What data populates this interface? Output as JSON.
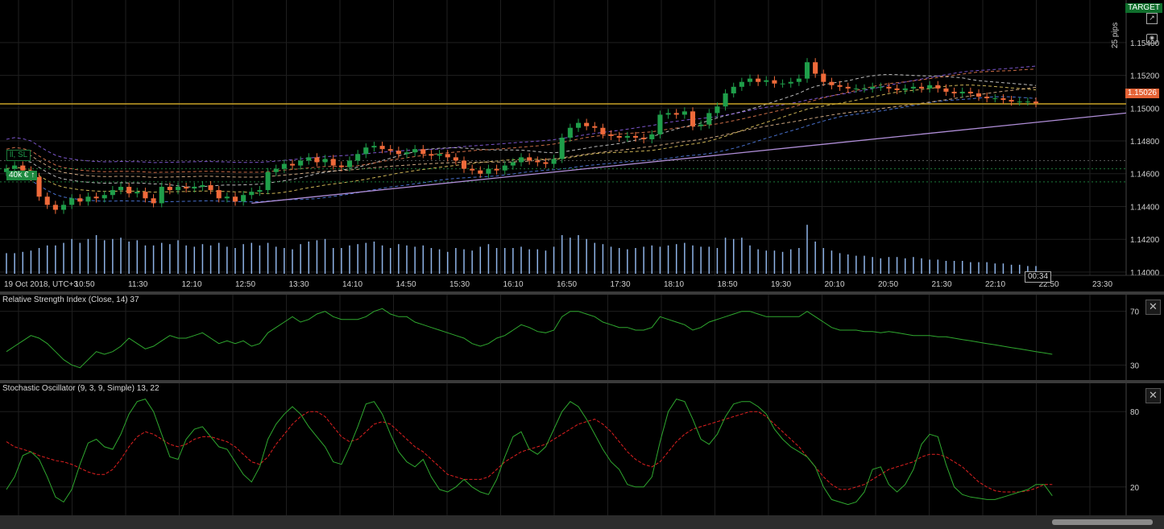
{
  "chart_data": [
    {
      "type": "candlestick",
      "x_ticks": [
        "19 Oct 2018, UTC+3",
        "10:50",
        "11:30",
        "12:10",
        "12:50",
        "13:30",
        "14:10",
        "14:50",
        "15:30",
        "16:10",
        "16:50",
        "17:30",
        "18:10",
        "18:50",
        "19:30",
        "20:10",
        "20:50",
        "21:30",
        "22:10",
        "22:50",
        "23:30"
      ],
      "y_ticks": [
        "1.15400",
        "1.15200",
        "1.15000",
        "1.14800",
        "1.14600",
        "1.14400",
        "1.14200",
        "1.14000"
      ],
      "ylim": [
        1.1398,
        1.1563
      ],
      "current_price": "1.15026",
      "countdown": "00:34",
      "target_label": "TARGET",
      "pips_label": "25 pips",
      "sl_label": "ll, SL",
      "position_label": "40k € ↑",
      "closes": [
        1.1463,
        1.1465,
        1.1462,
        1.1458,
        1.1446,
        1.1441,
        1.1438,
        1.1441,
        1.1445,
        1.1443,
        1.1446,
        1.1445,
        1.1447,
        1.145,
        1.1452,
        1.1448,
        1.1449,
        1.1445,
        1.1442,
        1.1452,
        1.145,
        1.1452,
        1.1451,
        1.1452,
        1.1453,
        1.145,
        1.1445,
        1.1446,
        1.1443,
        1.1447,
        1.1449,
        1.145,
        1.1461,
        1.1463,
        1.1466,
        1.1465,
        1.1468,
        1.147,
        1.1467,
        1.1469,
        1.1465,
        1.1464,
        1.1468,
        1.1472,
        1.1476,
        1.1477,
        1.1475,
        1.1474,
        1.1472,
        1.1473,
        1.1475,
        1.1472,
        1.1471,
        1.1472,
        1.147,
        1.1468,
        1.1463,
        1.1462,
        1.146,
        1.1463,
        1.1462,
        1.1465,
        1.1467,
        1.147,
        1.1468,
        1.1467,
        1.1466,
        1.1469,
        1.1482,
        1.1488,
        1.1491,
        1.1489,
        1.1488,
        1.1484,
        1.1483,
        1.1482,
        1.1483,
        1.1482,
        1.1481,
        1.1484,
        1.1496,
        1.1497,
        1.1496,
        1.1498,
        1.1489,
        1.149,
        1.1497,
        1.1501,
        1.1509,
        1.1513,
        1.1516,
        1.1518,
        1.1516,
        1.1517,
        1.1515,
        1.1515,
        1.1516,
        1.1518,
        1.1528,
        1.1521,
        1.1516,
        1.1514,
        1.1513,
        1.1512,
        1.1512,
        1.1512,
        1.1513,
        1.1513,
        1.1512,
        1.1511,
        1.1512,
        1.1513,
        1.1512,
        1.1514,
        1.1512,
        1.151,
        1.1509,
        1.151,
        1.1509,
        1.1507,
        1.1506,
        1.1506,
        1.1505,
        1.1504,
        1.1504,
        1.1504,
        1.1503
      ],
      "volumes": [
        16,
        16,
        17,
        18,
        20,
        22,
        22,
        24,
        27,
        24,
        27,
        30,
        26,
        27,
        28,
        25,
        26,
        22,
        22,
        24,
        23,
        26,
        22,
        21,
        23,
        22,
        24,
        21,
        20,
        23,
        24,
        22,
        24,
        21,
        20,
        19,
        23,
        25,
        26,
        27,
        20,
        20,
        22,
        23,
        24,
        25,
        22,
        20,
        23,
        22,
        21,
        22,
        20,
        19,
        17,
        20,
        19,
        18,
        21,
        23,
        20,
        20,
        20,
        21,
        19,
        19,
        18,
        21,
        30,
        28,
        30,
        27,
        24,
        23,
        21,
        20,
        19,
        20,
        21,
        22,
        21,
        22,
        23,
        24,
        22,
        21,
        21,
        20,
        28,
        27,
        28,
        22,
        19,
        18,
        18,
        17,
        19,
        20,
        38,
        25,
        20,
        18,
        16,
        15,
        14,
        14,
        13,
        12,
        13,
        13,
        12,
        13,
        12,
        11,
        11,
        10,
        10,
        10,
        9,
        9,
        9,
        8,
        8,
        7,
        7,
        6,
        6
      ],
      "rsi_title": "Relative Strength Index (Close, 14) 37",
      "rsi_ylim": [
        20,
        80
      ],
      "rsi_ticks": [
        "70",
        "30"
      ],
      "rsi": [
        40,
        44,
        48,
        52,
        50,
        46,
        40,
        34,
        30,
        28,
        34,
        40,
        38,
        40,
        44,
        50,
        46,
        42,
        44,
        48,
        52,
        50,
        50,
        52,
        54,
        50,
        46,
        48,
        46,
        48,
        44,
        46,
        54,
        58,
        62,
        66,
        62,
        64,
        68,
        70,
        66,
        64,
        64,
        64,
        66,
        70,
        72,
        68,
        66,
        66,
        62,
        60,
        58,
        56,
        54,
        52,
        50,
        46,
        44,
        46,
        50,
        52,
        56,
        60,
        58,
        55,
        54,
        56,
        66,
        70,
        70,
        68,
        66,
        62,
        60,
        58,
        58,
        56,
        56,
        58,
        66,
        64,
        62,
        60,
        56,
        58,
        62,
        64,
        66,
        68,
        70,
        70,
        68,
        66,
        66,
        66,
        66,
        66,
        70,
        66,
        62,
        58,
        56,
        56,
        56,
        55,
        55,
        54,
        55,
        54,
        53,
        52,
        52,
        52,
        51,
        51,
        50,
        49,
        48,
        47,
        46,
        45,
        44,
        43,
        42,
        41,
        40,
        39,
        38
      ],
      "stoch_title": "Stochastic Oscillator (9, 3, 9, Simple) 13, 22",
      "stoch_ylim": [
        0,
        100
      ],
      "stoch_ticks": [
        "80",
        "20"
      ],
      "stoch_k": [
        18,
        28,
        45,
        48,
        42,
        28,
        12,
        8,
        18,
        38,
        55,
        58,
        52,
        50,
        62,
        78,
        88,
        90,
        80,
        62,
        44,
        42,
        58,
        66,
        68,
        60,
        52,
        50,
        40,
        30,
        24,
        36,
        58,
        70,
        78,
        84,
        78,
        68,
        60,
        52,
        40,
        38,
        52,
        68,
        86,
        88,
        78,
        62,
        48,
        40,
        36,
        42,
        28,
        18,
        16,
        20,
        26,
        20,
        16,
        14,
        26,
        44,
        60,
        64,
        50,
        46,
        52,
        66,
        80,
        88,
        84,
        74,
        62,
        50,
        40,
        34,
        22,
        20,
        20,
        28,
        56,
        80,
        90,
        88,
        74,
        58,
        54,
        62,
        76,
        86,
        88,
        88,
        84,
        78,
        66,
        58,
        52,
        48,
        44,
        36,
        20,
        10,
        8,
        6,
        8,
        16,
        34,
        36,
        22,
        16,
        22,
        34,
        54,
        62,
        60,
        38,
        20,
        14,
        12,
        11,
        10,
        10,
        12,
        14,
        16,
        18,
        22,
        22,
        13
      ],
      "stoch_d": [
        56,
        52,
        50,
        48,
        45,
        43,
        41,
        40,
        38,
        35,
        32,
        30,
        30,
        34,
        42,
        52,
        60,
        64,
        62,
        58,
        54,
        52,
        54,
        58,
        60,
        60,
        58,
        56,
        52,
        46,
        40,
        38,
        44,
        54,
        62,
        70,
        76,
        80,
        80,
        76,
        68,
        60,
        56,
        58,
        64,
        70,
        72,
        70,
        64,
        58,
        52,
        48,
        42,
        36,
        30,
        28,
        26,
        26,
        26,
        28,
        34,
        40,
        44,
        48,
        50,
        52,
        54,
        58,
        62,
        66,
        70,
        72,
        74,
        70,
        64,
        56,
        48,
        42,
        38,
        36,
        40,
        48,
        56,
        62,
        66,
        68,
        70,
        72,
        74,
        76,
        78,
        80,
        80,
        76,
        70,
        64,
        58,
        52,
        44,
        36,
        28,
        22,
        18,
        18,
        20,
        22,
        26,
        30,
        34,
        36,
        38,
        40,
        44,
        46,
        46,
        44,
        40,
        36,
        30,
        24,
        20,
        17,
        16,
        16,
        16,
        17,
        19,
        22,
        22
      ]
    }
  ]
}
